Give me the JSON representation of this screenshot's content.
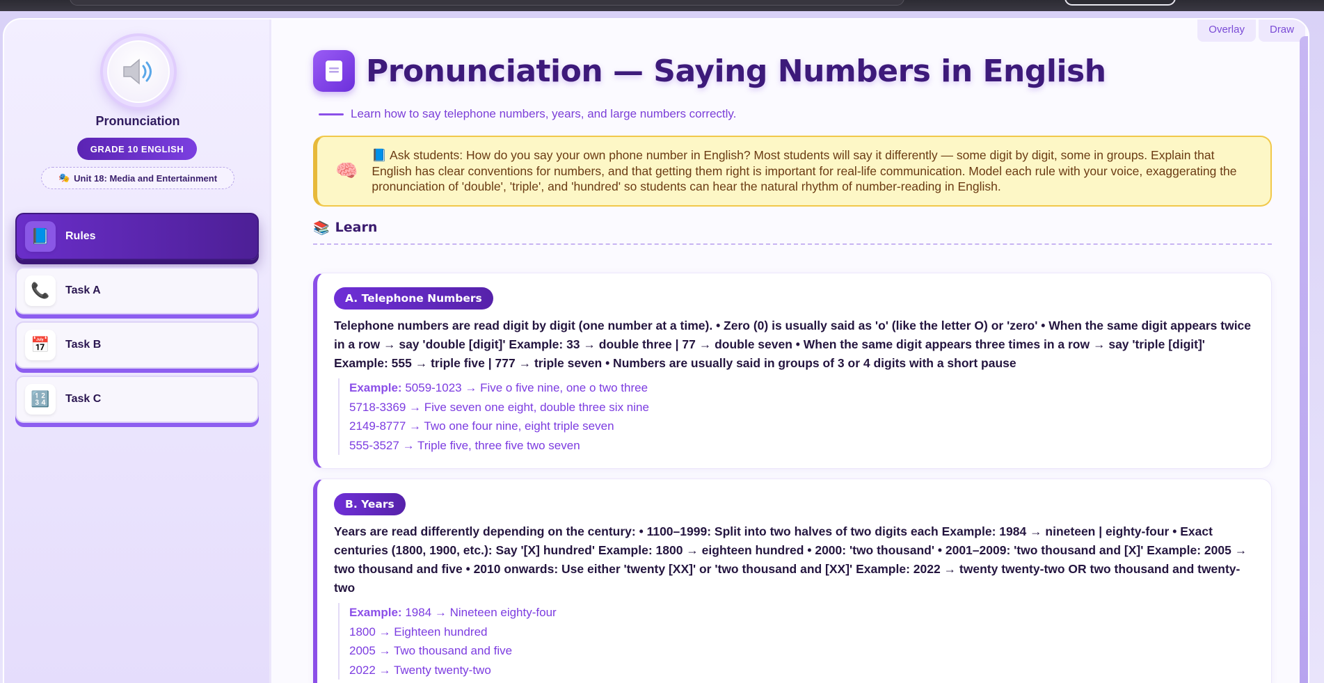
{
  "sidebar": {
    "title": "Pronunciation",
    "grade": "GRADE 10 ENGLISH",
    "unit_icon": "🎭",
    "unit": "Unit 18: Media and Entertainment",
    "nav": [
      {
        "label": "Rules",
        "icon": "📘",
        "active": true
      },
      {
        "label": "Task A",
        "icon": "📞",
        "active": false
      },
      {
        "label": "Task B",
        "icon": "📅",
        "active": false
      },
      {
        "label": "Task C",
        "icon": "🔢",
        "active": false
      }
    ]
  },
  "toolbar": {
    "overlay_label": "Overlay",
    "draw_label": "Draw"
  },
  "header": {
    "title": "Pronunciation — Saying Numbers in English",
    "subtitle": "Learn how to say telephone numbers, years, and large numbers correctly."
  },
  "tip": {
    "icon": "🧠",
    "text": "📘 Ask students: How do you say your own phone number in English? Most students will say it differently — some digit by digit, some in groups. Explain that English has clear conventions for numbers, and that getting them right is important for real-life communication. Model each rule with your voice, exaggerating the pronunciation of 'double', 'triple', and 'hundred' so students can hear the natural rhythm of number-reading in English."
  },
  "learn": {
    "icon": "📚",
    "heading": "Learn"
  },
  "cards": [
    {
      "badge": "A. Telephone Numbers",
      "desc": "Telephone numbers are read digit by digit (one number at a time). • Zero (0) is usually said as 'o' (like the letter O) or 'zero' • When the same digit appears twice in a row → say 'double [digit]' Example: 33 → double three | 77 → double seven • When the same digit appears three times in a row → say 'triple [digit]' Example: 555 → triple five | 777 → triple seven • Numbers are usually said in groups of 3 or 4 digits with a short pause",
      "example_label": "Example:",
      "examples": [
        "5059-1023 → Five o five nine, one o two three",
        "5718-3369 → Five seven one eight, double three six nine",
        "2149-8777 → Two one four nine, eight triple seven",
        "555-3527 → Triple five, three five two seven"
      ]
    },
    {
      "badge": "B. Years",
      "desc": "Years are read differently depending on the century: • 1100–1999: Split into two halves of two digits each Example: 1984 → nineteen | eighty-four • Exact centuries (1800, 1900, etc.): Say '[X] hundred' Example: 1800 → eighteen hundred • 2000: 'two thousand' • 2001–2009: 'two thousand and [X]' Example: 2005 → two thousand and five • 2010 onwards: Use either 'twenty [XX]' or 'two thousand and [XX]' Example: 2022 → twenty twenty-two OR two thousand and twenty-two",
      "example_label": "Example:",
      "examples": [
        "1984 → Nineteen eighty-four",
        "1800 → Eighteen hundred",
        "2005 → Two thousand and five",
        "2022 → Twenty twenty-two"
      ]
    }
  ]
}
